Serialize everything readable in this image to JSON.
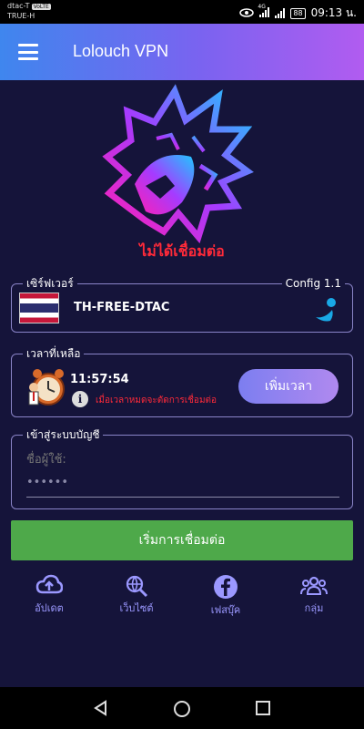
{
  "statusbar": {
    "carrier_line1": "dtac-T",
    "volte_badge": "VoLTE",
    "carrier_line2": "TRUE-H",
    "network_type": "4G",
    "battery": "88",
    "time": "09:13 น."
  },
  "appbar": {
    "title": "Lolouch VPN"
  },
  "connection": {
    "status_text": "ไม่ได้เชื่อมต่อ",
    "status_color": "#ff2a39"
  },
  "server": {
    "legend": "เซิร์ฟเวอร์",
    "config_label": "Config 1.1",
    "name": "TH-FREE-DTAC"
  },
  "time": {
    "legend": "เวลาที่เหลือ",
    "remaining": "11:57:54",
    "warning": "เมื่อเวลาหมดจะตัดการเชื่อมต่อ",
    "add_button": "เพิ่มเวลา"
  },
  "login": {
    "legend": "เข้าสู่ระบบบัญชี",
    "username_placeholder": "ชื่อผู้ใช้:",
    "password_value": "••••••"
  },
  "connect_button": "เริ่มการเชื่อมต่อ",
  "bottom_nav": {
    "items": [
      {
        "label": "อัปเดต",
        "icon": "cloud-upload-icon"
      },
      {
        "label": "เว็บไซต์",
        "icon": "globe-search-icon"
      },
      {
        "label": "เฟสบุ๊ค",
        "icon": "facebook-icon"
      },
      {
        "label": "กลุ่ม",
        "icon": "group-icon"
      }
    ]
  },
  "colors": {
    "background": "#15143a",
    "accent": "#9b98ff",
    "connect_button": "#4ea94a",
    "error": "#ff2a39"
  }
}
